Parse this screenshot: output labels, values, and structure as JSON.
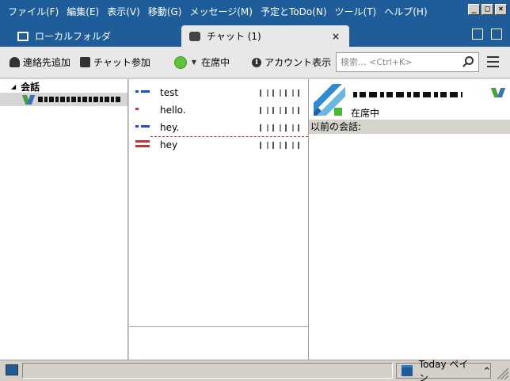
{
  "menubar": {
    "items": [
      "ファイル(F)",
      "編集(E)",
      "表示(V)",
      "移動(G)",
      "メッセージ(M)",
      "予定とToDo(N)",
      "ツール(T)",
      "ヘルプ(H)"
    ],
    "window_buttons": [
      "_",
      "□",
      "×"
    ]
  },
  "tabs": {
    "folder_label": "ローカルフォルダ",
    "chat_label": "チャット (1)",
    "chat_close": "×"
  },
  "toolbar": {
    "add_contact": "連絡先追加",
    "join_chat": "チャット参加",
    "presence": "在席中",
    "show_account": "アカウント表示",
    "search_placeholder": "検索... <Ctrl+K>"
  },
  "left_panel": {
    "section_title": "会話"
  },
  "messages": [
    {
      "text": "test",
      "flag": "blue"
    },
    {
      "text": "hello.",
      "flag": "red"
    },
    {
      "text": "hey.",
      "flag": "blue"
    },
    {
      "text": "hey",
      "flag": "dred"
    }
  ],
  "right_panel": {
    "buddy_status": "在席中",
    "previous_conversations": "以前の会話:"
  },
  "statusbar": {
    "today_pane": "Today ペイン"
  },
  "colors": {
    "titlebar": "#1f5d9a",
    "online": "#5ec23c",
    "flag_blue": "#1b4fcf",
    "flag_red": "#d23030"
  }
}
